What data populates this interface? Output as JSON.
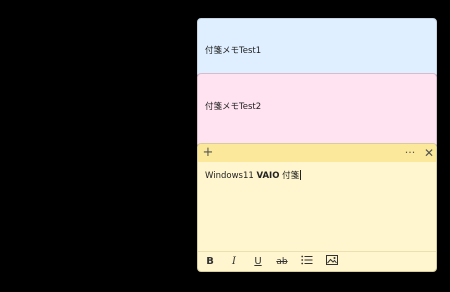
{
  "notes": [
    {
      "text": "付箋メモTest1",
      "color": "#dfefff"
    },
    {
      "text": "付箋メモTest2",
      "color": "#ffe3f1"
    }
  ],
  "active_note": {
    "color": "#fff6cf",
    "titlebar_color": "#fce89a",
    "add_symbol": "+",
    "menu_symbol": "···",
    "close_symbol": "✕",
    "content": {
      "part1": "Windows11 ",
      "part2_bold": "VAIO",
      "part3": " 付箋"
    },
    "toolbar": {
      "bold": "B",
      "italic": "I",
      "underline": "U",
      "strikethrough": "ab"
    }
  }
}
